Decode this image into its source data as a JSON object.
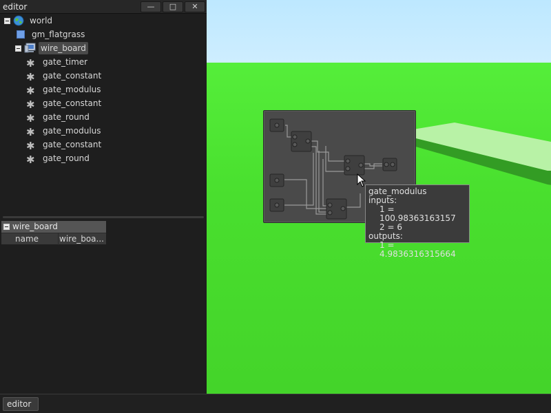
{
  "editor": {
    "title": "editor",
    "buttons": {
      "minimize": "—",
      "maximize": "□",
      "close": "✕"
    }
  },
  "tree": {
    "items": [
      {
        "label": "world",
        "icon": "globe-icon",
        "expanded": true
      },
      {
        "label": "gm_flatgrass",
        "icon": "square-icon"
      },
      {
        "label": "wire_board",
        "icon": "computer-icon",
        "expanded": true,
        "selected": true
      },
      {
        "label": "gate_timer",
        "icon": "puzzle-icon"
      },
      {
        "label": "gate_constant",
        "icon": "puzzle-icon"
      },
      {
        "label": "gate_modulus",
        "icon": "puzzle-icon"
      },
      {
        "label": "gate_constant",
        "icon": "puzzle-icon"
      },
      {
        "label": "gate_round",
        "icon": "puzzle-icon"
      },
      {
        "label": "gate_modulus",
        "icon": "puzzle-icon"
      },
      {
        "label": "gate_constant",
        "icon": "puzzle-icon"
      },
      {
        "label": "gate_round",
        "icon": "puzzle-icon"
      }
    ]
  },
  "properties": {
    "header": "wire_board",
    "rows": [
      {
        "key": "name",
        "value": "wire_boa..."
      }
    ]
  },
  "tooltip": {
    "title": "gate_modulus",
    "inputs_label": "inputs:",
    "input_1": "1 = 100.98363163157",
    "input_2": "2 = 6",
    "outputs_label": "outputs:",
    "output_1": "1 = 4.9836316315664"
  },
  "taskbar": {
    "editor_button": "editor"
  },
  "colors": {
    "grass": "#49df2e",
    "sky": "#c5ebff",
    "panel": "#1e1e1e",
    "board": "#4a4a4a"
  }
}
